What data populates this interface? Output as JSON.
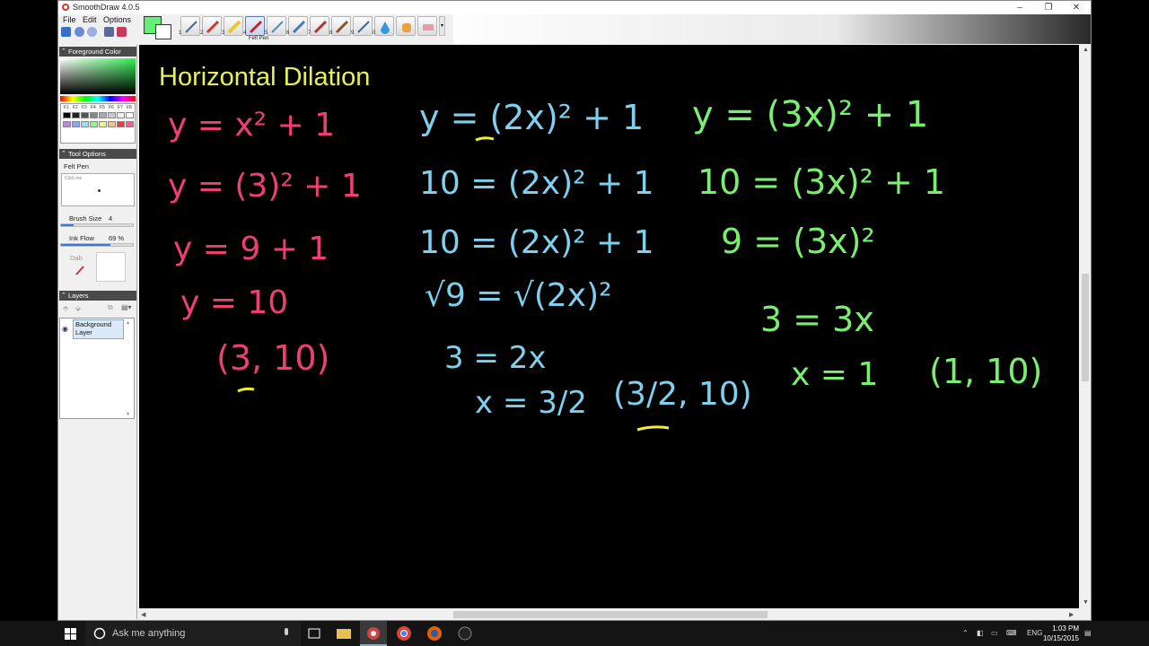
{
  "window": {
    "title": "SmoothDraw 4.0.5",
    "controls": {
      "minimize": "–",
      "maximize": "❐",
      "close": "✕"
    }
  },
  "menu": {
    "file": "File",
    "edit": "Edit",
    "options": "Options"
  },
  "toolbar": {
    "icons": [
      "save-icon",
      "undo-icon",
      "redo-icon",
      "page-icon",
      "camera-icon"
    ],
    "foreground_color": "#66ee77",
    "background_color": "#ffffff",
    "pens": [
      {
        "num": "1",
        "icon": "pen-icon"
      },
      {
        "num": "2",
        "icon": "pencil-icon"
      },
      {
        "num": "3",
        "icon": "highlighter-icon"
      },
      {
        "num": "4",
        "icon": "felt-pen-icon"
      },
      {
        "num": "5",
        "icon": "airbrush-icon"
      },
      {
        "num": "6",
        "icon": "brush-icon"
      },
      {
        "num": "7",
        "icon": "brush2-icon"
      },
      {
        "num": "8",
        "icon": "charcoal-icon"
      },
      {
        "num": "9",
        "icon": "water-icon"
      },
      {
        "num": "0",
        "icon": "drop-icon"
      },
      {
        "num": "",
        "icon": "hand-icon"
      },
      {
        "num": "",
        "icon": "eraser-icon"
      }
    ],
    "active_pen_label": "Felt Pen"
  },
  "panels": {
    "foreground_color": {
      "title": "Foreground Color",
      "palette_labels": [
        "F1",
        "F2",
        "F3",
        "F4",
        "F5",
        "F6",
        "F7",
        "F8"
      ],
      "swatches": [
        "#000000",
        "#222222",
        "#555555",
        "#888888",
        "#aaaaaa",
        "#cccccc",
        "#eeeeee",
        "#ffffff",
        "#b78ad8",
        "#8aa8f0",
        "#9ae0f0",
        "#9af09a",
        "#f0f09a",
        "#f0c090",
        "#e04040",
        "#f06090"
      ]
    },
    "tool_options": {
      "title": "Tool Options",
      "tool_name": "Felt Pen",
      "preview_hint": "Click me",
      "brush_size_label": "Brush Size",
      "brush_size_value": "4",
      "brush_size_fraction": 0.18,
      "ink_flow_label": "Ink Flow",
      "ink_flow_value": "69 %",
      "ink_flow_fraction": 0.69,
      "dab_label": "Dab"
    },
    "layers": {
      "title": "Layers",
      "items": [
        {
          "name": "Background Layer",
          "visible": true
        }
      ]
    }
  },
  "canvas": {
    "heading": "Horizontal Dilation",
    "colors": {
      "heading": "#e6f058",
      "pink": "#ee3f72",
      "blue": "#7ed0ee",
      "green": "#7aee70",
      "underline": "#f0f028"
    },
    "column1": [
      "y = x² + 1",
      "y = (3)² + 1",
      "y = 9 + 1",
      "y = 10",
      "(3, 10)"
    ],
    "column2": [
      "y = (2x)² + 1",
      "10 = (2x)² + 1",
      "10 = (2x)² + 1",
      "√9 = √(2x)²",
      "3 = 2x",
      "x = 3/2",
      "(3/2, 10)"
    ],
    "column3": [
      "y = (3x)² + 1",
      "10 = (3x)² + 1",
      "9 = (3x)²",
      "3 = 3x",
      "x = 1",
      "(1, 10)"
    ]
  },
  "taskbar": {
    "search_placeholder": "Ask me anything",
    "apps": [
      "task-view-icon",
      "file-explorer-icon",
      "smoothdraw-icon",
      "chrome-icon",
      "firefox-icon",
      "app-icon"
    ],
    "tray_lang": "ENG",
    "time": "1:03 PM",
    "date": "10/15/2015"
  }
}
